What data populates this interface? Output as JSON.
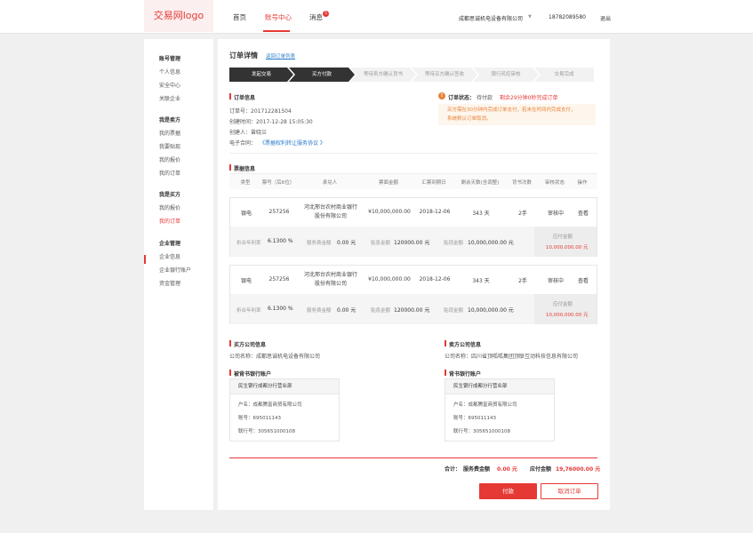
{
  "header": {
    "logo": "交易网logo",
    "nav": [
      "首页",
      "账号中心",
      "消息"
    ],
    "message_count": "5",
    "company": "成都思诚机电设备有限公司",
    "phone": "18782089580",
    "logout": "退出"
  },
  "sidebar": {
    "groups": [
      {
        "title": "账号管理",
        "items": [
          "个人信息",
          "安全中心",
          "关联企业"
        ]
      },
      {
        "title": "我是卖方",
        "items": [
          "我的票据",
          "我要贴现",
          "我的报价",
          "我的订单"
        ]
      },
      {
        "title": "我是买方",
        "items": [
          "我的报价",
          "我的订单"
        ]
      },
      {
        "title": "企业管理",
        "items": [
          "企业信息",
          "企业银行账户",
          "资金管理"
        ]
      }
    ]
  },
  "order": {
    "title": "订单详情",
    "back_link": "返回订单列表",
    "steps": [
      "发起交易",
      "买方付款",
      "等待卖方确认背书",
      "等待买方确认签收",
      "银行风控审核",
      "交易完成"
    ],
    "info_title": "订单信息",
    "order_no": "订单号：201712281504",
    "created_at": "创建时间：2017-12-28   15:05:30",
    "creator": "创建人：曾晓兰",
    "contract_label": "电子合同：",
    "contract_link": "《票据权利转让服务协议 》",
    "status_label": "订单状态：",
    "status_value": "待付款",
    "countdown": "剩余29分钟0秒完成订单",
    "notice_line1": "买方需在30分钟内完成订单支付，若未在时间内完成支付，",
    "notice_line2": "系统默认订单取消。"
  },
  "bills": {
    "title": "票据信息",
    "headers": [
      "类型",
      "票号（后6位）",
      "承兑人",
      "票面金额",
      "汇票到期日",
      "剩余天数(含调整)",
      "背书次数",
      "审核状态",
      "操作"
    ],
    "rows": [
      {
        "type": "银电",
        "no": "257256",
        "acceptor_1": "河北邢台农村商业银行",
        "acceptor_2": "股份有限公司",
        "amount": "¥10,000,000.00",
        "due": "2018-12-06",
        "days": "343 天",
        "endorse": "2手",
        "status": "审核中",
        "op": "查看",
        "rate_label": "折合年利率",
        "rate": "6.1300 %",
        "fee_label": "服务费金额",
        "fee": "0.00 元",
        "discount_label": "贴息金额",
        "discount": "120000.00 元",
        "net_label": "贴现金额",
        "net": "10,000,000.00 元",
        "pay_label": "应付金额",
        "pay": "10,000,000.00 元"
      },
      {
        "type": "银电",
        "no": "257256",
        "acceptor_1": "河北邢台农村商业银行",
        "acceptor_2": "股份有限公司",
        "amount": "¥10,000,000.00",
        "due": "2018-12-06",
        "days": "343 天",
        "endorse": "2手",
        "status": "审核中",
        "op": "查看",
        "rate_label": "折合年利率",
        "rate": "6.1300 %",
        "fee_label": "服务费金额",
        "fee": "0.00 元",
        "discount_label": "贴息金额",
        "discount": "120000.00 元",
        "net_label": "贴现金额",
        "net": "10,000,000.00 元",
        "pay_label": "应付金额",
        "pay": "10,000,000.00 元"
      }
    ]
  },
  "buyer": {
    "title": "买方公司信息",
    "company": "公司名称：成都思诚机电设备有限公司",
    "bank_title": "被背书银行账户",
    "bank_name": "民生银行成都分行营业部",
    "account_name": "户名：成都腾富商贸有限公司",
    "account_no": "账号：695011143",
    "bank_no": "联行号：305651000108"
  },
  "seller": {
    "title": "卖方公司信息",
    "company": "公司名称：四川省顶呱呱集团顶联互动科技信息有限公司",
    "bank_title": "背书银行账户",
    "bank_name": "民生银行成都分行营业部",
    "account_name": "户名：成都腾富商贸有限公司",
    "account_no": "账号：695011143",
    "bank_no": "联行号：305651000108"
  },
  "summary": {
    "total_label": "合计：",
    "fee_label": "服务费金额",
    "fee": "0.00 元",
    "pay_label": "应付金额",
    "pay": "19,76000.00 元"
  },
  "actions": {
    "pay": "付款",
    "cancel": "取消订单"
  },
  "colors": {
    "accent": "#e53935",
    "link": "#2979c9",
    "step_active": "#333333",
    "step_inactive": "#f2f2f2"
  }
}
